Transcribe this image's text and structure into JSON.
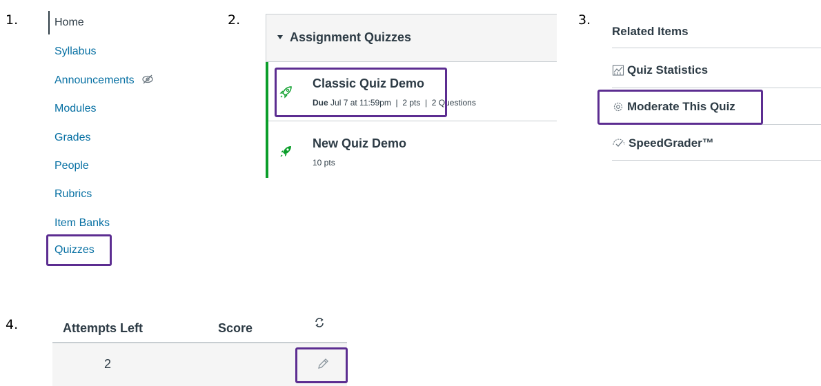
{
  "steps": [
    "1.",
    "2.",
    "3.",
    "4."
  ],
  "course_nav": {
    "items": [
      {
        "label": "Home",
        "active": true
      },
      {
        "label": "Syllabus"
      },
      {
        "label": "Announcements"
      },
      {
        "label": "Modules"
      },
      {
        "label": "Grades"
      },
      {
        "label": "People"
      },
      {
        "label": "Rubrics"
      },
      {
        "label": "Item Banks"
      },
      {
        "label": "Quizzes",
        "highlighted": true
      }
    ]
  },
  "quiz_list": {
    "header": "Assignment Quizzes",
    "quizzes": [
      {
        "title": "Classic Quiz Demo",
        "due_label": "Due",
        "due_date": "Jul 7 at 11:59pm",
        "points": "2 pts",
        "questions": "2 Questions",
        "icon": "rocket-outline-icon"
      },
      {
        "title": "New Quiz Demo",
        "points": "10 pts",
        "icon": "rocket-filled-icon"
      }
    ]
  },
  "related_items": {
    "title": "Related Items",
    "items": [
      {
        "label": "Quiz Statistics",
        "icon": "chart-icon"
      },
      {
        "label": "Moderate This Quiz",
        "icon": "gear-icon",
        "highlighted": true
      },
      {
        "label": "SpeedGrader™",
        "icon": "speedgrader-icon"
      }
    ]
  },
  "attempts_table": {
    "headers": [
      "Attempts Left",
      "Score"
    ],
    "refresh_icon": "refresh-icon",
    "rows": [
      {
        "attempts_left": "2",
        "score": "",
        "action_icon": "pencil-icon"
      }
    ]
  },
  "colors": {
    "link": "#0770a3",
    "text": "#2d3b45",
    "highlight": "#5c2d91",
    "published": "#0b9e2a",
    "border": "#c7cdd1"
  }
}
